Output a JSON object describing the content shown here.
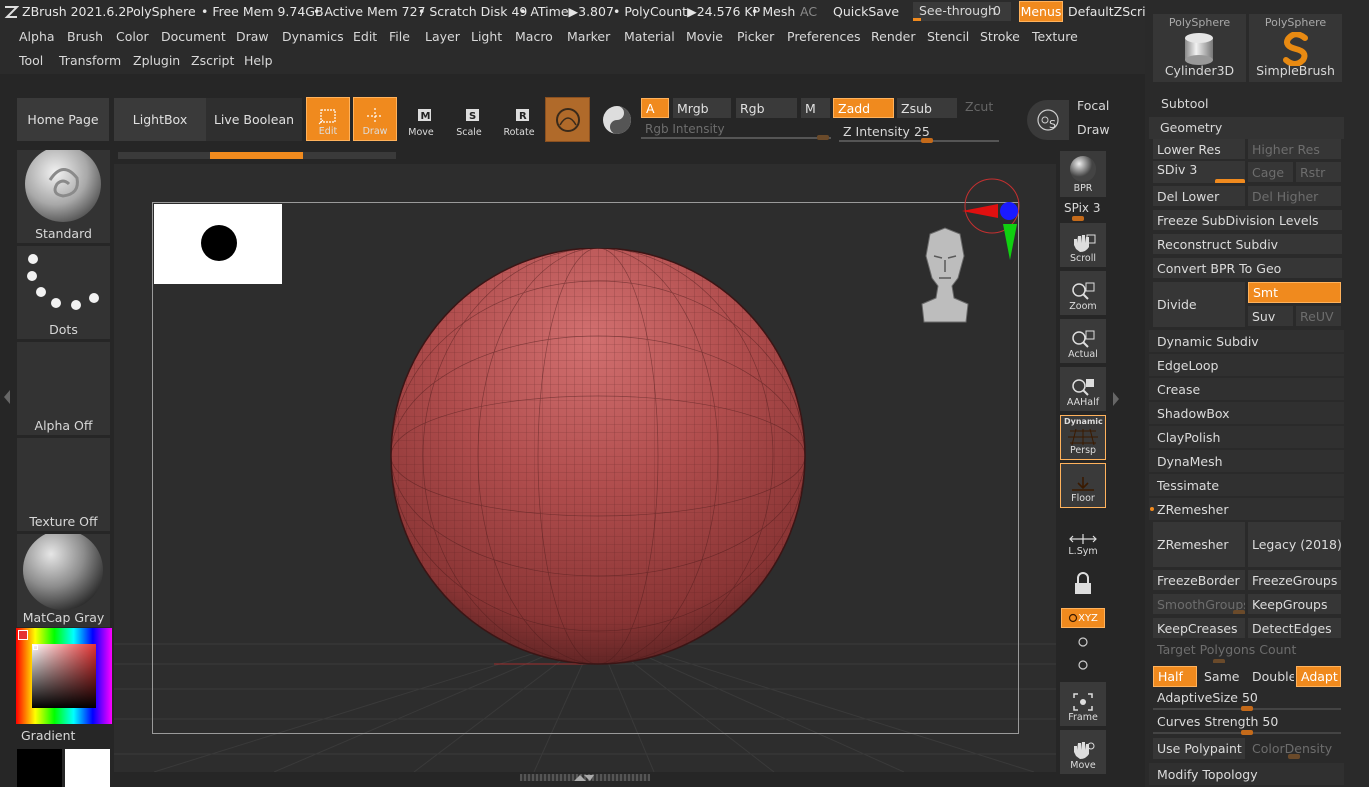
{
  "titlebar": {
    "app": "ZBrush 2021.6.2",
    "tool": "PolySphere",
    "free_mem": "• Free Mem 9.74GB",
    "active_mem": "• Active Mem 727",
    "scratch": "• Scratch Disk 49",
    "atime": "• ATime▶3.807",
    "polycount": "• PolyCount▶24.576 KP",
    "mesh": "• Mesh",
    "ac": "AC",
    "quicksave": "QuickSave",
    "seethrough_label": "See-through",
    "seethrough_value": "0",
    "menus": "Menus",
    "script": "DefaultZScript"
  },
  "menu_row1": [
    "Alpha",
    "Brush",
    "Color",
    "Document",
    "Draw",
    "Dynamics",
    "Edit",
    "File",
    "Layer",
    "Light",
    "Macro",
    "Marker",
    "Material",
    "Movie",
    "Picker",
    "Preferences",
    "Render",
    "Stencil",
    "Stroke",
    "Texture"
  ],
  "menu_row2": [
    "Tool",
    "Transform",
    "Zplugin",
    "Zscript",
    "Help"
  ],
  "toolbar": {
    "home": "Home Page",
    "lightbox": "LightBox",
    "live_boolean": "Live Boolean",
    "edit": "Edit",
    "draw": "Draw",
    "move": "Move",
    "scale": "Scale",
    "rotate": "Rotate",
    "a": "A",
    "mrgb": "Mrgb",
    "rgb": "Rgb",
    "m": "M",
    "zadd": "Zadd",
    "zsub": "Zsub",
    "zcut": "Zcut",
    "rgb_intensity": "Rgb Intensity",
    "z_intensity_label": "Z Intensity",
    "z_intensity": "25",
    "z_intensity_level": 0.25,
    "focal": "Focal",
    "draw2": "Draw"
  },
  "left_shelf": {
    "brush": "Standard",
    "stroke": "Dots",
    "alpha": "Alpha Off",
    "texture": "Texture Off",
    "material": "MatCap Gray",
    "gradient": "Gradient"
  },
  "right_shelf": {
    "bpr": "BPR",
    "spix_label": "SPix",
    "spix": "3",
    "scroll": "Scroll",
    "zoom": "Zoom",
    "actual": "Actual",
    "aahalf": "AAHalf",
    "dynamic": "Dynamic",
    "persp": "Persp",
    "floor": "Floor",
    "lsym": "L.Sym",
    "xyz": "XYZ",
    "frame": "Frame",
    "move": "Move"
  },
  "panel": {
    "polysphere_a": "PolySphere",
    "polysphere_b": "PolySphere",
    "cylinder": "Cylinder3D",
    "simplebrush": "SimpleBrush",
    "subtool": "Subtool",
    "geometry": "Geometry",
    "lower_res": "Lower Res",
    "higher_res": "Higher Res",
    "sdiv_label": "SDiv",
    "sdiv": "3",
    "cage": "Cage",
    "rstr": "Rstr",
    "del_lower": "Del Lower",
    "del_higher": "Del Higher",
    "freeze_sub": "Freeze SubDivision Levels",
    "reconstruct": "Reconstruct Subdiv",
    "convert_bpr": "Convert BPR To Geo",
    "divide": "Divide",
    "smt": "Smt",
    "suv": "Suv",
    "reuv": "ReUV",
    "dynamic_subdiv": "Dynamic Subdiv",
    "edgeloop": "EdgeLoop",
    "crease": "Crease",
    "shadowbox": "ShadowBox",
    "claypolish": "ClayPolish",
    "dynamesh": "DynaMesh",
    "tessimate": "Tessimate",
    "zremesher_hdr": "ZRemesher",
    "zremesher": "ZRemesher",
    "legacy": "Legacy (2018)",
    "freezeborder": "FreezeBorder",
    "freezegroups": "FreezeGroups",
    "smoothgroups": "SmoothGroups",
    "keepgroups": "KeepGroups",
    "keepcreases": "KeepCreases",
    "detectedges": "DetectEdges",
    "target_poly": "Target Polygons Count",
    "half": "Half",
    "same": "Same",
    "double": "Double",
    "adapt": "Adapt",
    "adaptive_label": "AdaptiveSize",
    "adaptive": "50",
    "curves_label": "Curves Strength",
    "curves": "50",
    "use_polypaint": "Use Polypaint",
    "colordensity": "ColorDensity",
    "modify_topology": "Modify Topology"
  },
  "colors": {
    "accent": "#f08a1e",
    "sphere": "#b24e4e",
    "panel_bg": "#2a2a2a"
  }
}
